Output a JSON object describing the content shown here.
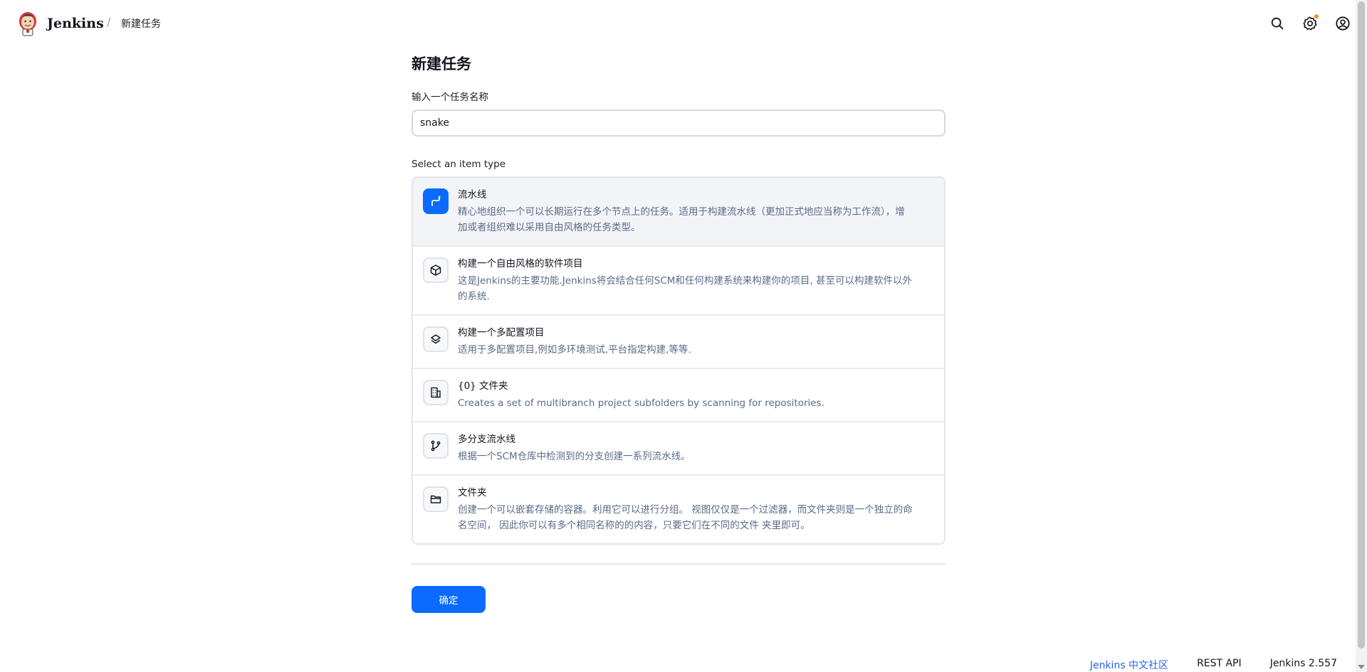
{
  "header": {
    "brand": "Jenkins",
    "breadcrumb_sep": "/",
    "breadcrumb": "新建任务",
    "icons": [
      "search-icon",
      "settings-icon",
      "user-icon"
    ],
    "notification_color": "#fe8a1b"
  },
  "main": {
    "title": "新建任务",
    "name_label": "输入一个任务名称",
    "name_value": "snake",
    "type_label": "Select an item type",
    "types": [
      {
        "name": "流水线",
        "desc": "精心地组织一个可以长期运行在多个节点上的任务。适用于构建流水线（更加正式地应当称为工作流），增加或者组织难以采用自由风格的任务类型。",
        "icon": "pipeline-icon",
        "selected": true
      },
      {
        "name": "构建一个自由风格的软件项目",
        "desc": "这是Jenkins的主要功能.Jenkins将会结合任何SCM和任何构建系统来构建你的项目, 甚至可以构建软件以外的系统.",
        "icon": "cube-icon",
        "selected": false
      },
      {
        "name": "构建一个多配置项目",
        "desc": "适用于多配置项目,例如多环境测试,平台指定构建,等等.",
        "icon": "layers-icon",
        "selected": false
      },
      {
        "name": "{0} 文件夹",
        "desc": "Creates a set of multibranch project subfolders by scanning for repositories.",
        "icon": "building-icon",
        "selected": false
      },
      {
        "name": "多分支流水线",
        "desc": "根据一个SCM仓库中检测到的分支创建一系列流水线。",
        "icon": "branch-icon",
        "selected": false
      },
      {
        "name": "文件夹",
        "desc": "创建一个可以嵌套存储的容器。利用它可以进行分组。 视图仅仅是一个过滤器，而文件夹则是一个独立的命名空间， 因此你可以有多个相同名称的的内容，只要它们在不同的文件 夹里即可。",
        "icon": "folder-icon",
        "selected": false
      }
    ],
    "ok_label": "确定",
    "accent": "#0b6bff"
  },
  "footer": {
    "community": "Jenkins 中文社区",
    "rest_api": "REST API",
    "version": "Jenkins 2.557"
  }
}
